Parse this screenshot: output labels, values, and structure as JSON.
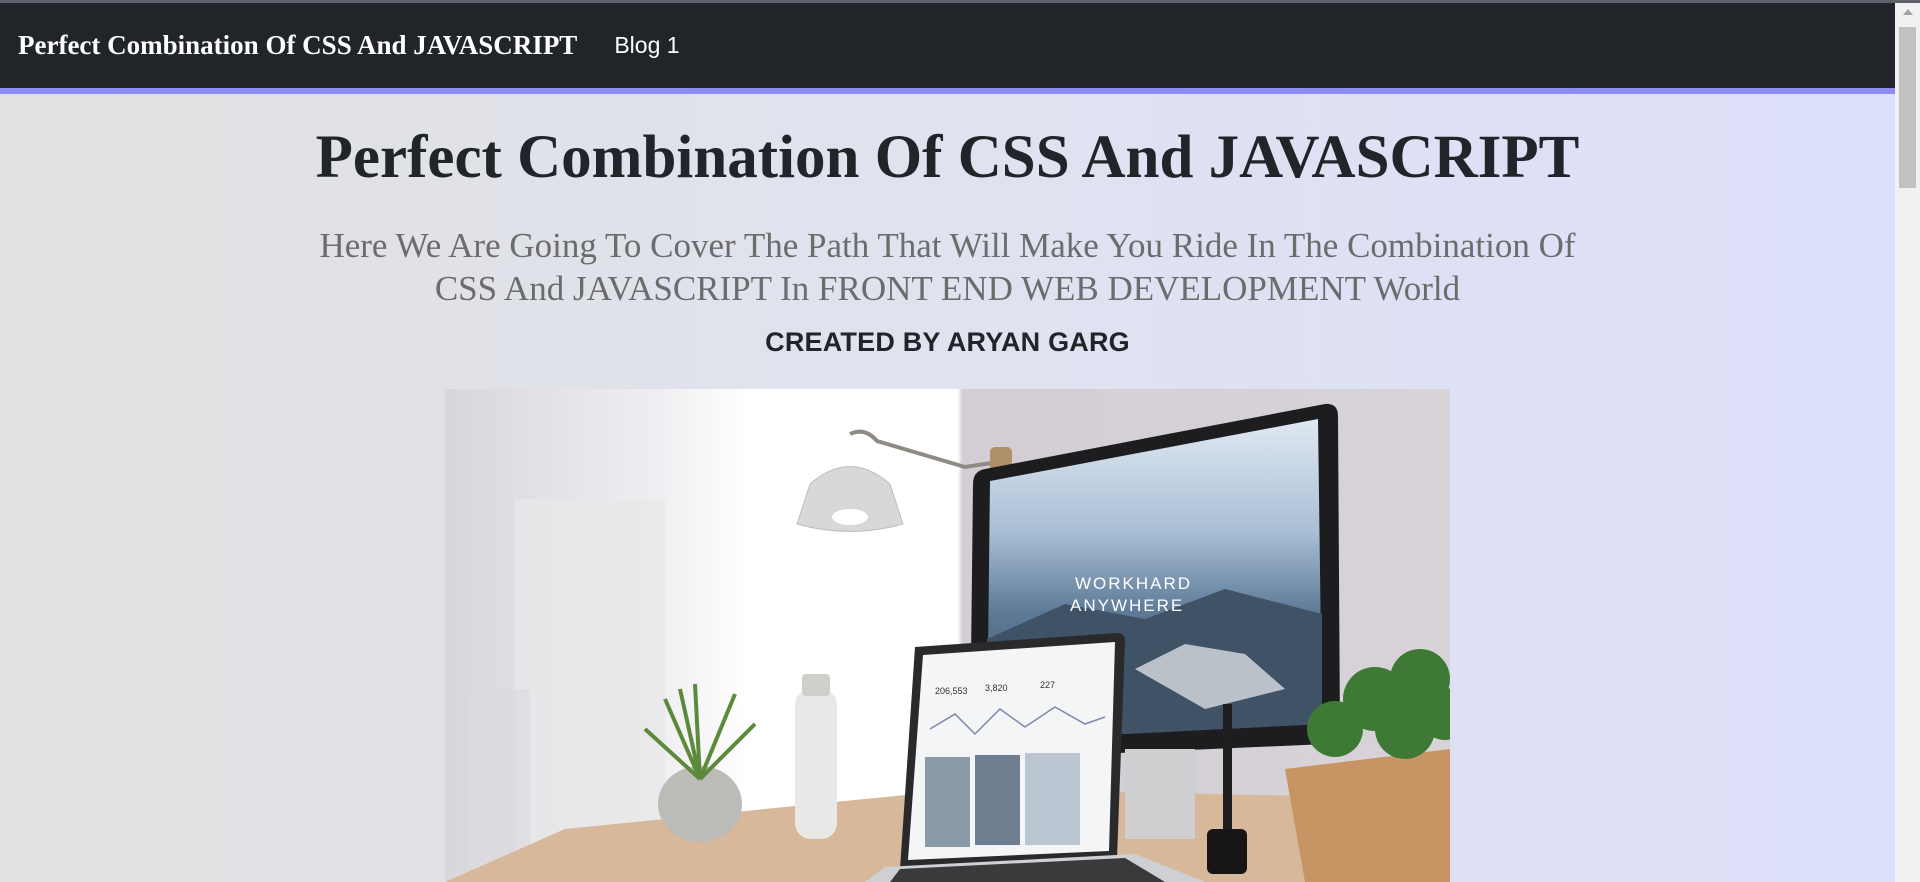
{
  "navbar": {
    "brand": "Perfect Combination Of CSS And JAVASCRIPT",
    "links": [
      {
        "label": "Blog 1"
      }
    ]
  },
  "main": {
    "title": "Perfect Combination Of CSS And JAVASCRIPT",
    "subtitle": "Here We Are Going To Cover The Path That Will Make You Ride In The Combination Of CSS And JAVASCRIPT In FRONT END WEB DEVELOPMENT World",
    "author": "CREATED BY ARYAN GARG",
    "hero_image": {
      "monitor_text_line1": "WORKHARD",
      "monitor_text_line2": "ANYWHERE",
      "laptop_stats": [
        "206,553",
        "3,820",
        "227"
      ]
    }
  },
  "colors": {
    "navbar_bg": "#212529",
    "accent": "#8e8ef2",
    "title": "#212529",
    "subtitle": "#6c6c6c"
  }
}
